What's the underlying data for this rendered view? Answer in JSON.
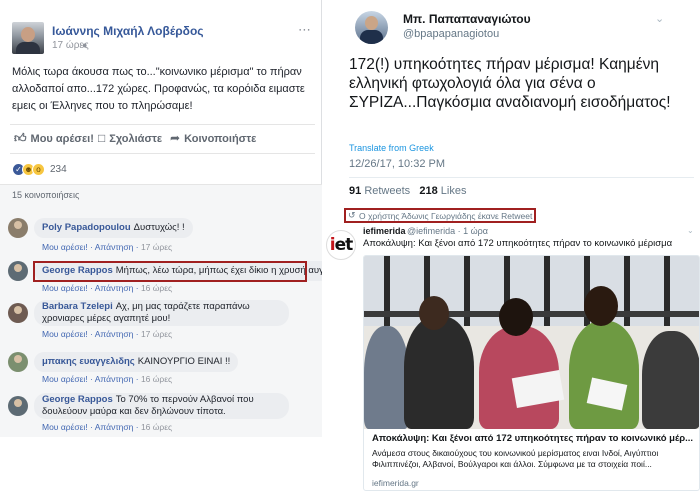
{
  "facebook": {
    "author": "Ιωάννης Μιχαήλ Λοβέρδος",
    "time": "17 ώρες",
    "post_text": "Μόλις τωρα άκουσα πως το...\"κοινωνικο μέρισμα\" το πήραν αλλοδαποί απο...172 χώρες. Προφανώς, τα κορόιδα ειμαστε εμεις οι Έλληνες που το πληρώσαμε!",
    "actions": {
      "like": "Μου αρέσει!",
      "comment": "Σχολιάστε",
      "share": "Κοινοποιήστε"
    },
    "reaction_count": "234",
    "shares": "15 κοινοποιήσεις",
    "comments": [
      {
        "name": "Poly Papadopoulou",
        "text": "Δυστυχώς! !",
        "like": "Μου αρέσει!",
        "reply": "Απάντηση",
        "time": "17 ώρες"
      },
      {
        "name": "George Rappos",
        "text": "Μήπως, λέω τώρα, μήπως έχει δίκιο η χρυσή αυγή?",
        "like": "Μου αρέσει!",
        "reply": "Απάντηση",
        "time": "16 ώρες"
      },
      {
        "name": "Barbara Tzelepi",
        "text": "Αχ, μη μας ταράζετε παραπάνω χρονιαρες μέρες αγαπητέ μου!",
        "like": "Μου αρέσει!",
        "reply": "Απάντηση",
        "time": "17 ώρες"
      },
      {
        "name": "μπακης ευαγγελιδης",
        "text": "ΚΑΙΝΟΥΡΓΙΟ ΕΙΝΑΙ !!",
        "like": "Μου αρέσει!",
        "reply": "Απάντηση",
        "time": "16 ώρες"
      },
      {
        "name": "George Rappos",
        "text": "Το 70% το περνούν Αλβανοί που δουλεύουν μαύρα και δεν δηλώνουν τίποτα.",
        "like": "Μου αρέσει!",
        "reply": "Απάντηση",
        "time": "16 ώρες"
      }
    ]
  },
  "twitter": {
    "name": "Μπ. Παπαπαναγιώτου",
    "handle": "@bpapapanagiotou",
    "text": "172(!) υπηκοότητες πήραν μέρισμα! Καημένη ελληνική φτωχολογιά  όλα για σένα ο ΣΥΡΙΖΑ...Παγκόσμια αναδιανομή εισοδήματος!",
    "translate": "Translate from Greek",
    "date": "12/26/17, 10:32 PM",
    "retweets_count": "91",
    "retweets_label": "Retweets",
    "likes_count": "218",
    "likes_label": "Likes"
  },
  "retweet_notice": "Ο χρήστης Άδωνις Γεωργιάδης έκανε Retweet",
  "iefimerida": {
    "logo": "iet",
    "name": "iefimerida",
    "meta": "@iefimerida · 1 ώρα",
    "text": "Αποκάλυψη: Και ξένοι από 172 υπηκοότητες πήραν το κοινωνικό μέρισμα",
    "card_title": "Αποκάλυψη: Και ξένοι από 172 υπηκοότητες πήραν το κοινωνικό μέρ...",
    "card_desc": "Ανάμεσα στους δικαιούχους του κοινωνικού μερίσματος ειναι Ινδοί, Αιγύπτιοι Φιλιππινέζοι, Αλβανοί, Βούλγαροι και άλλοι. Σύμφωνα με τα στοιχεία ποιί...",
    "card_domain": "iefimerida.gr"
  },
  "icons": {
    "like": "thumbs-up-icon",
    "comment": "speech-bubble-icon",
    "share": "share-arrow-icon",
    "retweet": "retweet-icon",
    "chevron": "chevron-down-icon"
  },
  "colors": {
    "fb_link": "#365899",
    "tw_link": "#1b95e0",
    "highlight": "#a02020"
  }
}
